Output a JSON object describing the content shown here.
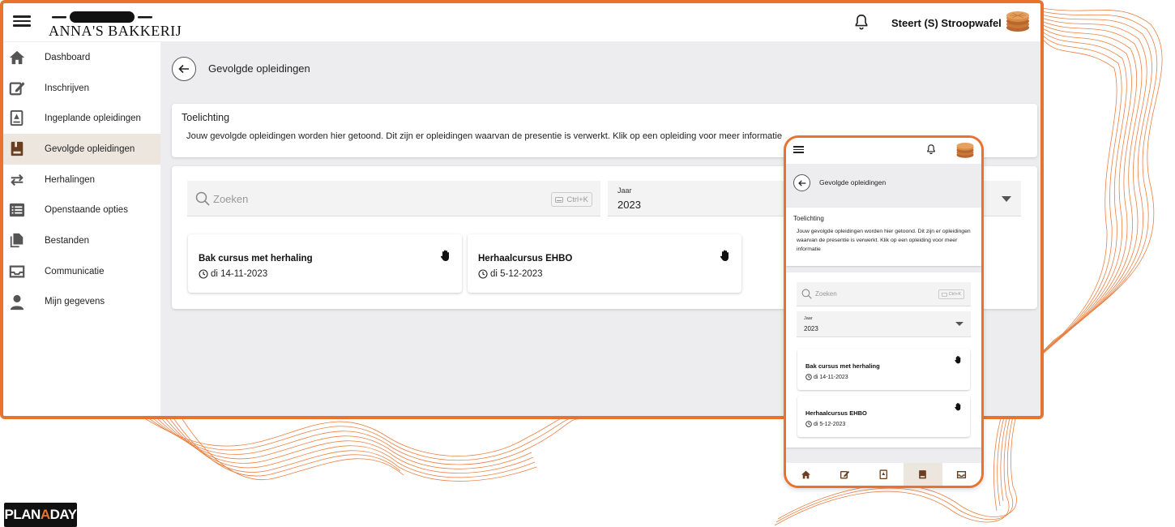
{
  "brand": {
    "logo_text": "ANNA'S BAKKERIJ",
    "accent_color": "#e8732f",
    "footer_logo": {
      "part1": "PLAN",
      "accent": "A",
      "part2": "DAY"
    }
  },
  "header": {
    "user_name": "Steert (S) Stroopwafel"
  },
  "sidebar": {
    "items": [
      {
        "label": "Dashboard",
        "icon": "home-icon"
      },
      {
        "label": "Inschrijven",
        "icon": "edit-icon"
      },
      {
        "label": "Ingeplande opleidingen",
        "icon": "calendar-book-icon"
      },
      {
        "label": "Gevolgde opleidingen",
        "icon": "book-icon",
        "active": true
      },
      {
        "label": "Herhalingen",
        "icon": "repeat-icon"
      },
      {
        "label": "Openstaande opties",
        "icon": "list-icon"
      },
      {
        "label": "Bestanden",
        "icon": "files-icon"
      },
      {
        "label": "Communicatie",
        "icon": "inbox-icon"
      },
      {
        "label": "Mijn gegevens",
        "icon": "person-icon"
      }
    ]
  },
  "page": {
    "title": "Gevolgde opleidingen",
    "explanation_title": "Toelichting",
    "explanation_text": "Jouw gevolgde opleidingen worden hier getoond. Dit zijn er opleidingen waarvan de presentie is verwerkt. Klik op een opleiding voor meer informatie",
    "search_placeholder": "Zoeken",
    "search_shortcut": "Ctrl+K",
    "year_label": "Jaar",
    "year_value": "2023"
  },
  "courses": [
    {
      "title": "Bak cursus met herhaling",
      "date": "di 14-11-2023"
    },
    {
      "title": "Herhaalcursus EHBO",
      "date": "di 5-12-2023"
    }
  ]
}
